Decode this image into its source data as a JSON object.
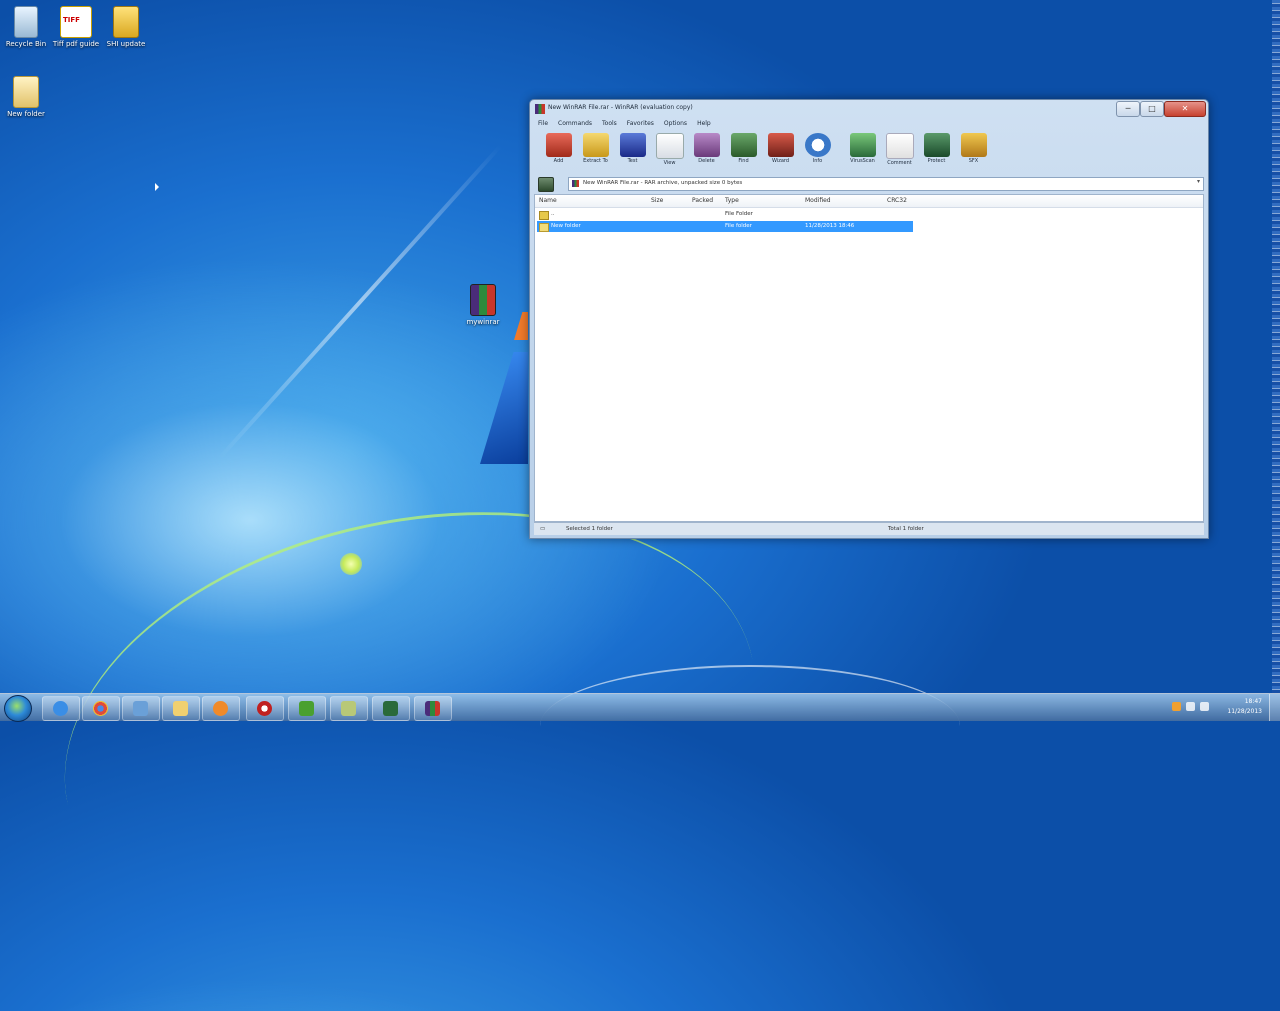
{
  "desktop": {
    "icons": [
      {
        "label": "Recycle Bin",
        "icon": "recycle-bin-icon"
      },
      {
        "label": "Tiff pdf guide",
        "icon": "document-icon"
      },
      {
        "label": "SHI update",
        "icon": "zip-folder-icon"
      },
      {
        "label": "New folder",
        "icon": "folder-icon"
      },
      {
        "label": "mywinrar",
        "icon": "winrar-archive-icon"
      }
    ]
  },
  "window": {
    "title": "New WinRAR File.rar - WinRAR (evaluation copy)",
    "controls": {
      "minimize": "─",
      "maximize": "□",
      "close": "✕"
    },
    "menu": [
      "File",
      "Commands",
      "Tools",
      "Favorites",
      "Options",
      "Help"
    ],
    "toolbar": [
      {
        "label": "Add",
        "icon": "add-icon",
        "color": "#c0392b"
      },
      {
        "label": "Extract To",
        "icon": "extract-icon",
        "color": "#e0b030"
      },
      {
        "label": "Test",
        "icon": "test-icon",
        "color": "#2a4aa8"
      },
      {
        "label": "View",
        "icon": "view-icon",
        "color": "#f3f3f3"
      },
      {
        "label": "Delete",
        "icon": "delete-icon",
        "color": "#8a5a9a"
      },
      {
        "label": "Find",
        "icon": "find-icon",
        "color": "#3c7a3c"
      },
      {
        "label": "Wizard",
        "icon": "wizard-icon",
        "color": "#a0302a"
      },
      {
        "label": "Info",
        "icon": "info-icon",
        "color": "#3a78c8"
      },
      {
        "label": "VirusScan",
        "icon": "virusscan-icon",
        "color": "#3c8a4a"
      },
      {
        "label": "Comment",
        "icon": "comment-icon",
        "color": "#f5f5f5"
      },
      {
        "label": "Protect",
        "icon": "protect-icon",
        "color": "#2f6b3a"
      },
      {
        "label": "SFX",
        "icon": "sfx-icon",
        "color": "#d8a020"
      }
    ],
    "address": "New WinRAR File.rar - RAR archive, unpacked size 0 bytes",
    "columns": [
      "Name",
      "Size",
      "Packed",
      "Type",
      "Modified",
      "CRC32"
    ],
    "rows": [
      {
        "name": "..",
        "size": "",
        "packed": "",
        "type": "File Folder",
        "modified": "",
        "crc": "",
        "selected": false
      },
      {
        "name": "New folder",
        "size": "",
        "packed": "",
        "type": "File folder",
        "modified": "11/28/2013 18:46",
        "crc": "",
        "selected": true
      }
    ],
    "status_left_icon": "▭",
    "status_left": "Selected 1 folder",
    "status_right": "Total 1 folder"
  },
  "taskbar": {
    "apps": [
      {
        "icon": "internet-explorer-icon",
        "color": "#3a8ee6"
      },
      {
        "icon": "chrome-icon",
        "color": "#e04a3a"
      },
      {
        "icon": "paint-icon",
        "color": "#6aa0d8"
      },
      {
        "icon": "explorer-icon",
        "color": "#f0d070"
      },
      {
        "icon": "media-player-icon",
        "color": "#f08a2a"
      },
      {
        "icon": "opera-icon",
        "color": "#c02020"
      },
      {
        "icon": "android-icon",
        "color": "#4aa030"
      },
      {
        "icon": "camera-icon",
        "color": "#b8c878"
      },
      {
        "icon": "flag-icon",
        "color": "#2a6a3a"
      },
      {
        "icon": "winrar-icon",
        "color": "#6a3a8a"
      }
    ],
    "clock_time": "18:47",
    "clock_date": "11/28/2013"
  }
}
